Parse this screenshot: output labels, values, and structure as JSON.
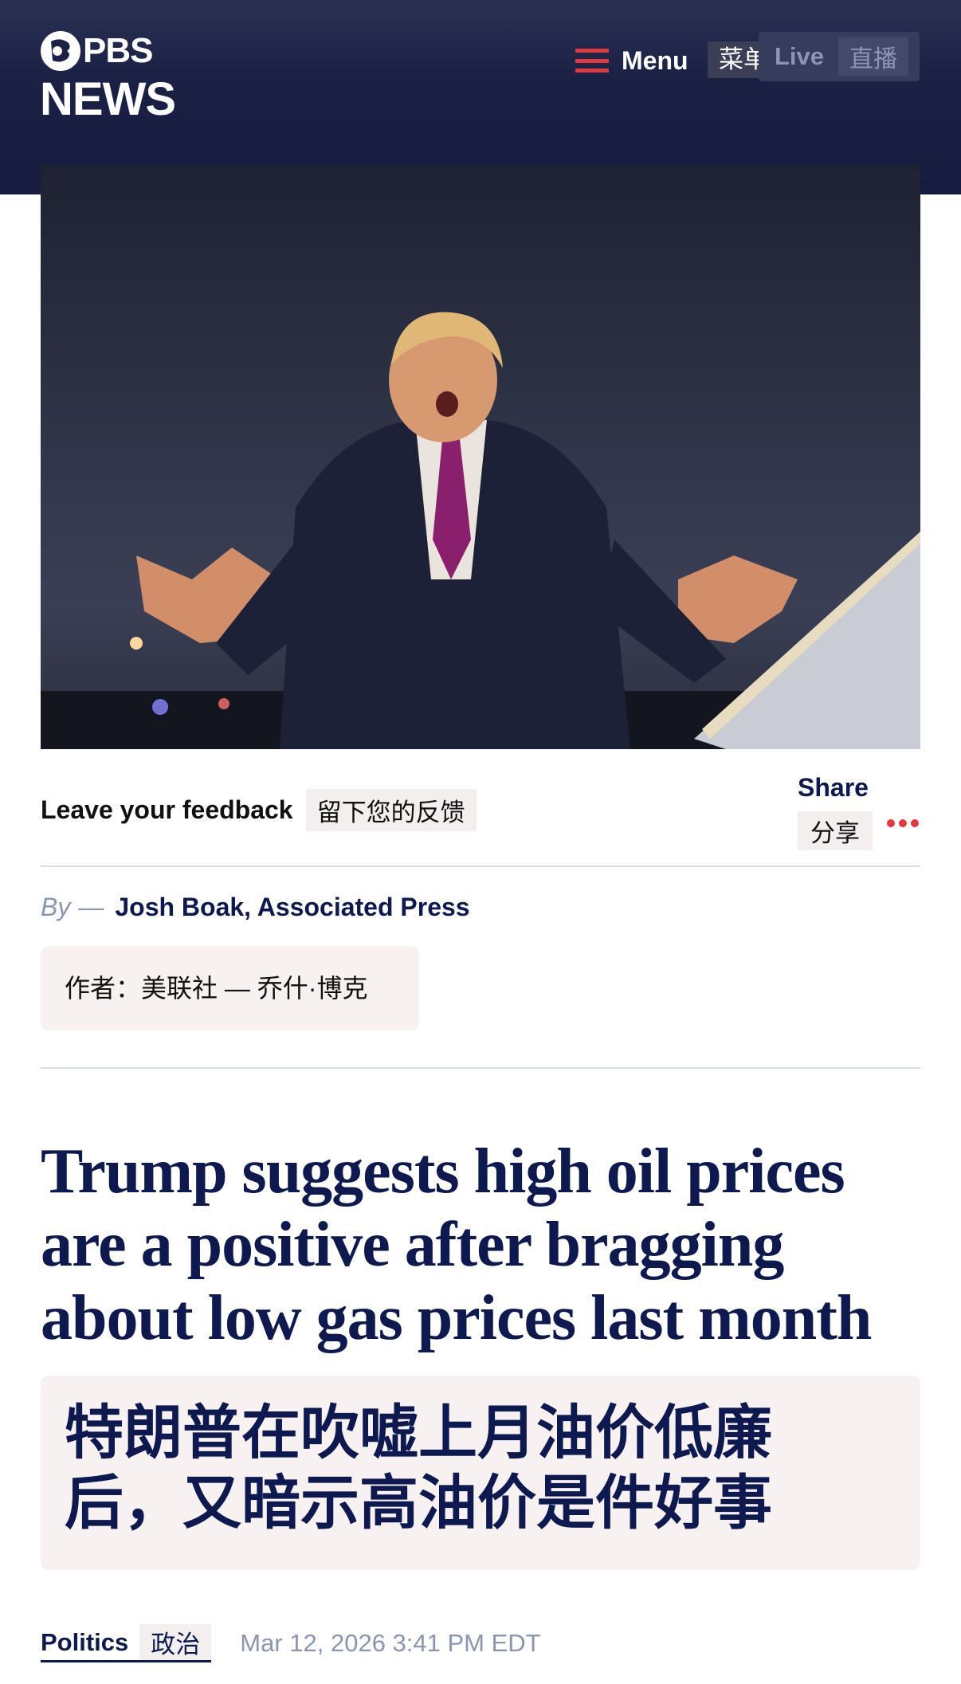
{
  "header": {
    "logo": {
      "top": "PBS",
      "bottom": "NEWS"
    },
    "menu_label": "Menu",
    "menu_label_cn": "菜单",
    "live_label": "Live",
    "live_label_cn": "直播",
    "colors": {
      "background": "#1b2145",
      "accent": "#e0393e"
    }
  },
  "hero": {
    "icons": [
      "photo"
    ]
  },
  "feedback": {
    "label": "Leave your feedback",
    "label_cn": "留下您的反馈"
  },
  "share": {
    "label": "Share",
    "label_cn": "分享",
    "more_icon": "more-dots-icon"
  },
  "byline": {
    "by": "By",
    "dash": "—",
    "author": "Josh Boak, Associated Press",
    "author_cn": "作者：美联社 — 乔什·博克"
  },
  "article": {
    "headline": "Trump suggests high oil prices are a positive after bragging about low gas prices last month",
    "headline_cn_line1": "特朗普在吹嘘上月油价低廉",
    "headline_cn_line2": "后，又暗示高油价是件好事",
    "category": "Politics",
    "category_cn": "政治",
    "date": "Mar 12, 2026 3:41 PM EDT"
  }
}
